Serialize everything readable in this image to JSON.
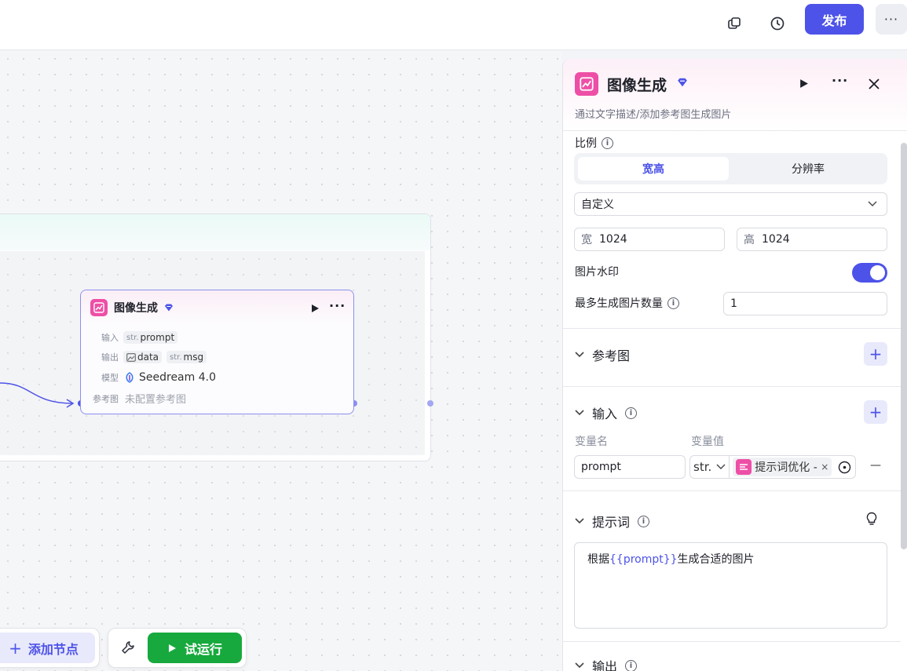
{
  "topbar": {
    "publish_label": "发布",
    "more_label": "···",
    "icons": [
      "copy-icon",
      "history-icon",
      "more-icon"
    ]
  },
  "canvas": {
    "node": {
      "title": "图像生成",
      "input_label": "输入",
      "output_label": "输出",
      "model_label": "模型",
      "ref_label": "参考图",
      "input_vars": [
        {
          "type": "str.",
          "name": "prompt"
        }
      ],
      "output_vars": [
        {
          "type": "image",
          "name": "data"
        },
        {
          "type": "str.",
          "name": "msg"
        }
      ],
      "model_name": "Seedream 4.0",
      "ref_value": "未配置参考图"
    },
    "add_node_label": "添加节点",
    "trial_run_label": "试运行"
  },
  "panel": {
    "title": "图像生成",
    "description": "通过文字描述/添加参考图生成图片",
    "ratio_label": "比例",
    "ratio_tabs": [
      "宽高",
      "分辨率"
    ],
    "ratio_active_tab": "宽高",
    "preset": "自定义",
    "width_prefix": "宽",
    "width_value": "1024",
    "height_prefix": "高",
    "height_value": "1024",
    "watermark_label": "图片水印",
    "watermark_on": true,
    "max_count_label": "最多生成图片数量",
    "max_count_value": "1",
    "ref_section_title": "参考图",
    "input_section_title": "输入",
    "var_name_header": "变量名",
    "var_value_header": "变量值",
    "input_var_name": "prompt",
    "input_var_type": "str.",
    "input_var_ref": "提示词优化 -",
    "remove_label": "—",
    "prompt_section_title": "提示词",
    "prompt_before": "根据",
    "prompt_var": "{{prompt}}",
    "prompt_after": "生成合适的图片",
    "output_section_title": "输出"
  },
  "colors": {
    "accent": "#4d53e8",
    "node_pink": "#ee4fa6",
    "run_green": "#17a93d"
  }
}
